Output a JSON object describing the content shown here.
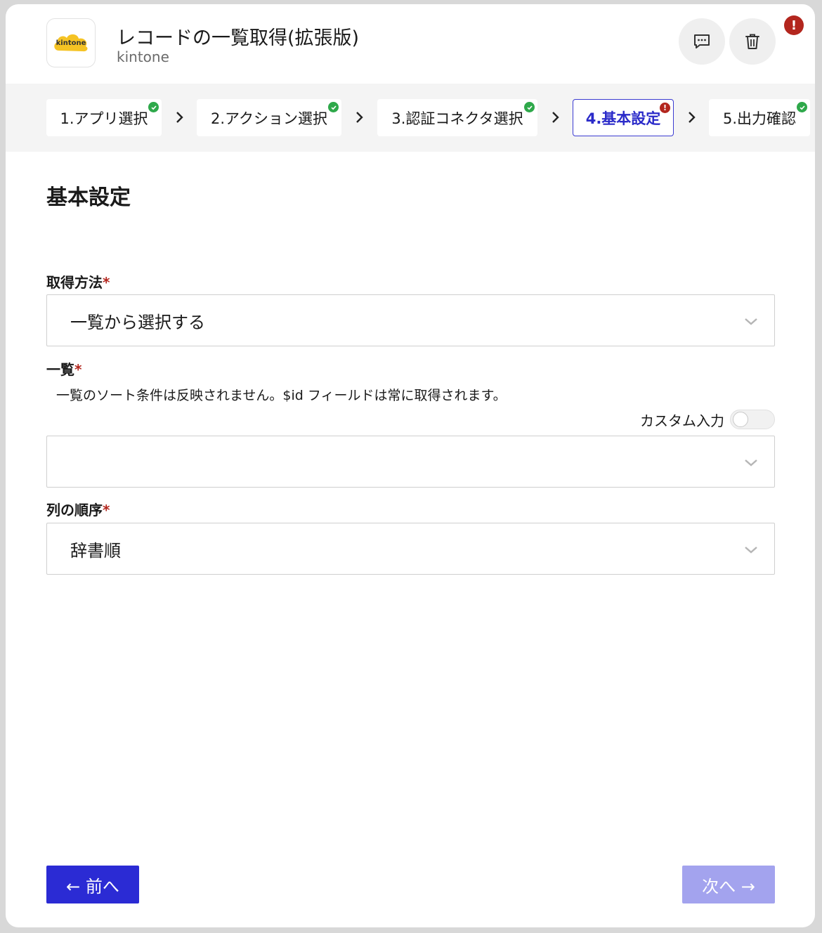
{
  "header": {
    "app_logo_text": "kintone",
    "title": "レコードの一覧取得(拡張版)",
    "subtitle": "kintone",
    "alert_badge": "!"
  },
  "stepper": {
    "steps": [
      {
        "label": "1.アプリ選択",
        "status": "done"
      },
      {
        "label": "2.アクション選択",
        "status": "done"
      },
      {
        "label": "3.認証コネクタ選択",
        "status": "done"
      },
      {
        "label": "4.基本設定",
        "status": "error",
        "active": true
      },
      {
        "label": "5.出力確認",
        "status": "done"
      }
    ],
    "error_mark": "!"
  },
  "main": {
    "section_title": "基本設定",
    "required_mark": "*",
    "fields": [
      {
        "label": "取得方法",
        "value": "一覧から選択する"
      },
      {
        "label": "一覧",
        "value": "",
        "help": "一覧のソート条件は反映されません。$id フィールドは常に取得されます。",
        "custom_input_label": "カスタム入力",
        "custom_input_on": false
      },
      {
        "label": "列の順序",
        "value": "辞書順"
      }
    ]
  },
  "footer": {
    "prev_label": "← 前へ",
    "next_label": "次へ →"
  },
  "colors": {
    "primary": "#2b2bd4",
    "primary_disabled": "#a3a3ee",
    "success": "#2ea84a",
    "error": "#b3261e",
    "kintone_yellow": "#f5c324"
  }
}
